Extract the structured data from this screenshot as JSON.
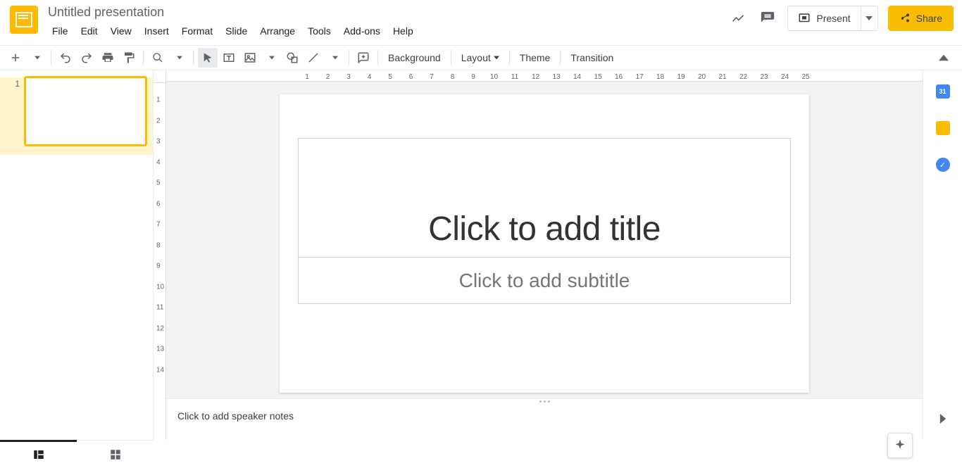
{
  "doc": {
    "title": "Untitled presentation"
  },
  "menus": [
    "File",
    "Edit",
    "View",
    "Insert",
    "Format",
    "Slide",
    "Arrange",
    "Tools",
    "Add-ons",
    "Help"
  ],
  "header": {
    "present": "Present",
    "share": "Share"
  },
  "toolbar": {
    "background": "Background",
    "layout": "Layout",
    "theme": "Theme",
    "transition": "Transition"
  },
  "slide": {
    "number": "1",
    "title_placeholder": "Click to add title",
    "subtitle_placeholder": "Click to add subtitle"
  },
  "notes": {
    "placeholder": "Click to add speaker notes"
  },
  "ruler_h": [
    1,
    2,
    3,
    4,
    5,
    6,
    7,
    8,
    9,
    10,
    11,
    12,
    13,
    14,
    15,
    16,
    17,
    18,
    19,
    20,
    21,
    22,
    23,
    24,
    25
  ],
  "ruler_v": [
    1,
    2,
    3,
    4,
    5,
    6,
    7,
    8,
    9,
    10,
    11,
    12,
    13,
    14
  ]
}
